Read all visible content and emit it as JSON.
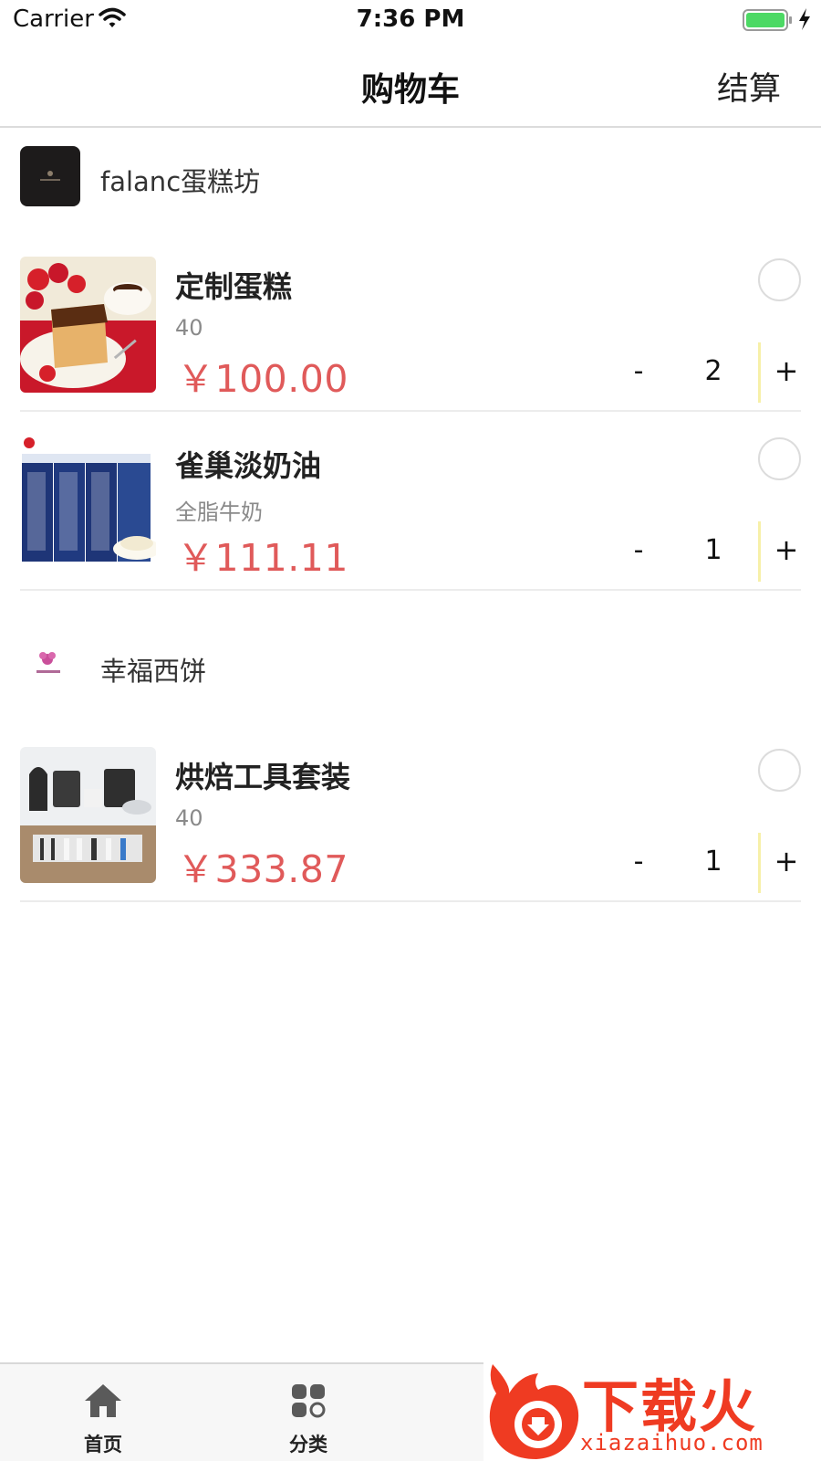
{
  "status_bar": {
    "carrier": "Carrier",
    "time": "7:36 PM"
  },
  "nav": {
    "title": "购物车",
    "checkout_label": "结算"
  },
  "shops": [
    {
      "name": "falanc蛋糕坊",
      "logo_icon": "shop-logo-dark",
      "items": [
        {
          "name": "定制蛋糕",
          "spec": "40",
          "price": "￥100.00",
          "quantity": "2",
          "minus": "-",
          "plus": "+",
          "thumb_icon": "cake-image"
        },
        {
          "name": "雀巢淡奶油",
          "spec": "全脂牛奶",
          "price": "￥111.11",
          "quantity": "1",
          "minus": "-",
          "plus": "+",
          "thumb_icon": "cream-box-image"
        }
      ]
    },
    {
      "name": "幸福西饼",
      "logo_icon": "shop-logo-pink-flower",
      "items": [
        {
          "name": "烘焙工具套装",
          "spec": "40",
          "price": "￥333.87",
          "quantity": "1",
          "minus": "-",
          "plus": "+",
          "thumb_icon": "baking-tools-image"
        }
      ]
    }
  ],
  "tabs": [
    {
      "label": "首页",
      "icon": "home-icon"
    },
    {
      "label": "分类",
      "icon": "grid-icon"
    }
  ],
  "watermark": {
    "text": "下载火",
    "url": "xiazaihuo.com"
  },
  "colors": {
    "price": "#e05a5a",
    "watermark": "#ef3b22",
    "qty_separator": "#f7f0a8"
  }
}
